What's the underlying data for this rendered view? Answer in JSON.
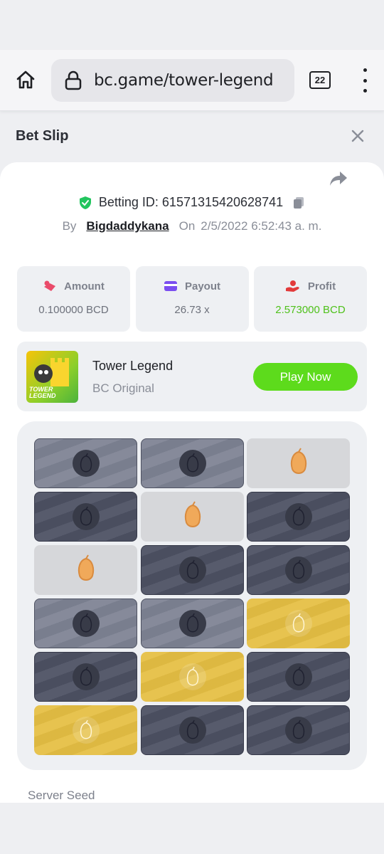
{
  "browser": {
    "url": "bc.game/tower-legend",
    "tab_count": "22"
  },
  "header": {
    "title": "Bet Slip"
  },
  "bet": {
    "betting_label": "Betting ID: 61571315420628741",
    "by_label": "By",
    "username": "Bigdaddykana",
    "on_label": "On",
    "datetime": "2/5/2022 6:52:43 a. m."
  },
  "stats": {
    "amount": {
      "label": "Amount",
      "value": "0.100000 BCD"
    },
    "payout": {
      "label": "Payout",
      "value": "26.73 x"
    },
    "profit": {
      "label": "Profit",
      "value": "2.573000 BCD"
    }
  },
  "game": {
    "title": "Tower Legend",
    "subtitle": "BC Original",
    "thumb_text": "TOWER LEGEND",
    "play_label": "Play Now"
  },
  "board": {
    "rows": [
      [
        "light",
        "light",
        "gray-fruit"
      ],
      [
        "dark",
        "gray-fruit",
        "dark"
      ],
      [
        "gray-fruit",
        "dark",
        "dark"
      ],
      [
        "light",
        "light",
        "gold"
      ],
      [
        "dark",
        "gold",
        "dark"
      ],
      [
        "gold",
        "dark",
        "dark"
      ]
    ]
  },
  "footer": {
    "server_seed_label": "Server Seed"
  },
  "colors": {
    "accent_green": "#5ddb1c",
    "profit_green": "#4fc11b",
    "gold_tile": "#e6bf44"
  }
}
